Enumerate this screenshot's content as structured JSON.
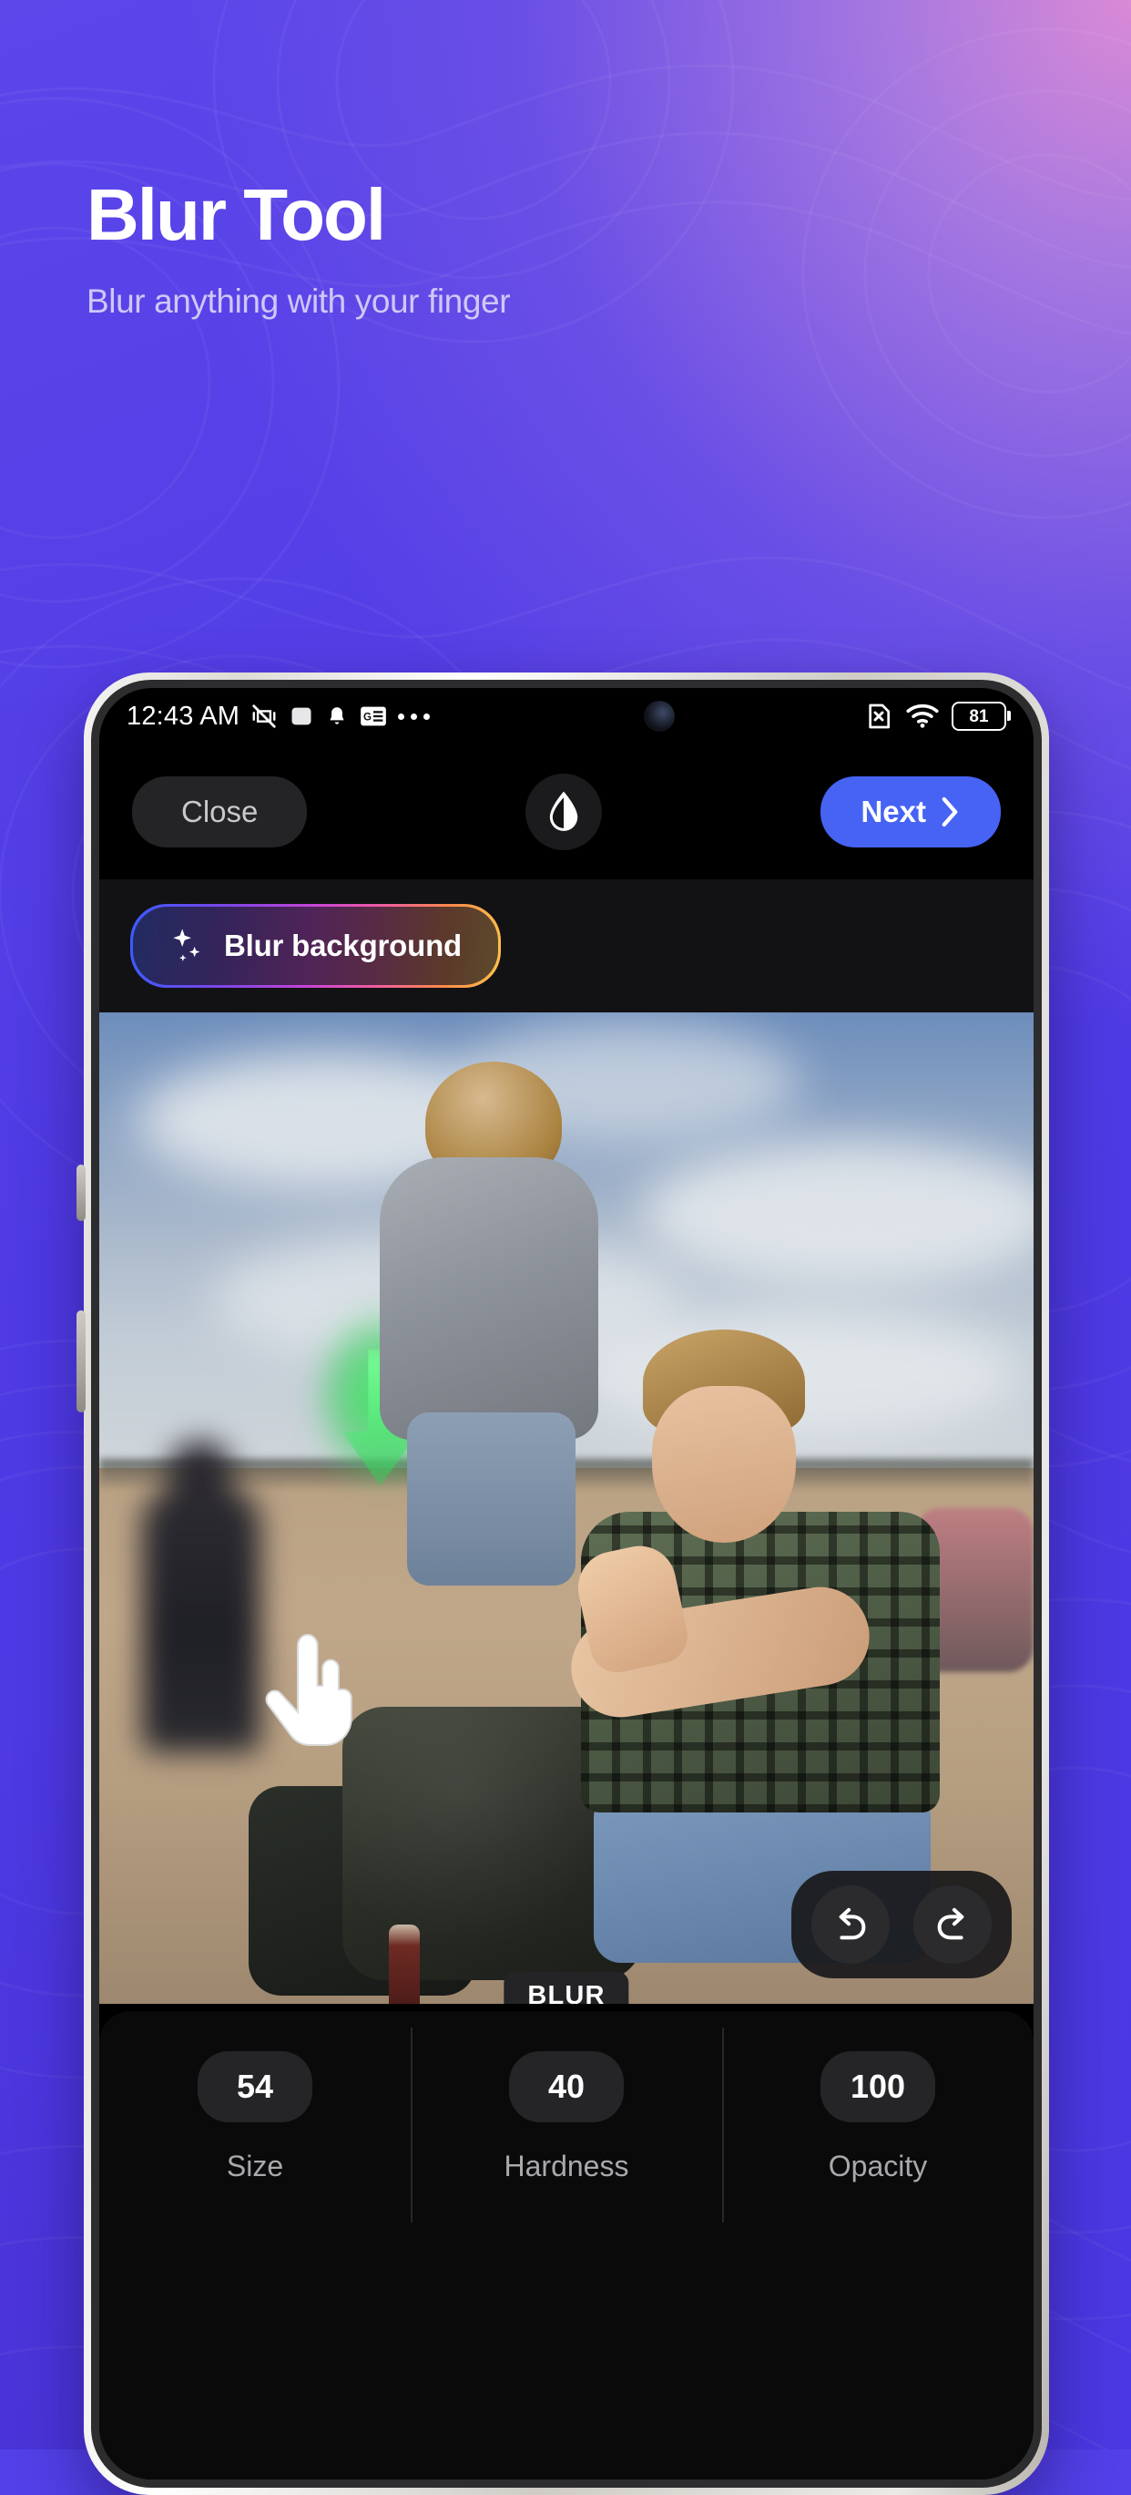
{
  "hero": {
    "title": "Blur Tool",
    "subtitle": "Blur anything with your finger"
  },
  "colors": {
    "background_purple": "#4f3ae4",
    "accent_blue": "#4763f4",
    "editor_black": "#000000",
    "panel_dark": "#0a0a0b",
    "pill_dark": "#252528",
    "text_muted": "#a9a9ad"
  },
  "phone": {
    "status_bar": {
      "time": "12:43 AM",
      "icons_left": [
        "vibrate-off-icon",
        "app-square-icon",
        "bell-icon",
        "google-news-icon",
        "overflow-dots-icon"
      ],
      "icons_right": [
        "sim-off-icon",
        "wifi-icon",
        "battery-icon"
      ],
      "battery_level": "81"
    },
    "toolbar": {
      "close_label": "Close",
      "contrast_icon": "droplet-contrast-icon",
      "next_label": "Next",
      "next_chevron": "chevron-right-icon"
    },
    "promo_chip": {
      "label": "Blur background",
      "icon": "sparkle-icon"
    },
    "canvas": {
      "brush_badge": "BLUR",
      "cursor_icon": "pointing-hand-icon",
      "undo_icon": "undo-arrow-icon",
      "redo_icon": "redo-arrow-icon"
    },
    "controls": [
      {
        "value": "54",
        "label": "Size"
      },
      {
        "value": "40",
        "label": "Hardness"
      },
      {
        "value": "100",
        "label": "Opacity"
      }
    ]
  }
}
